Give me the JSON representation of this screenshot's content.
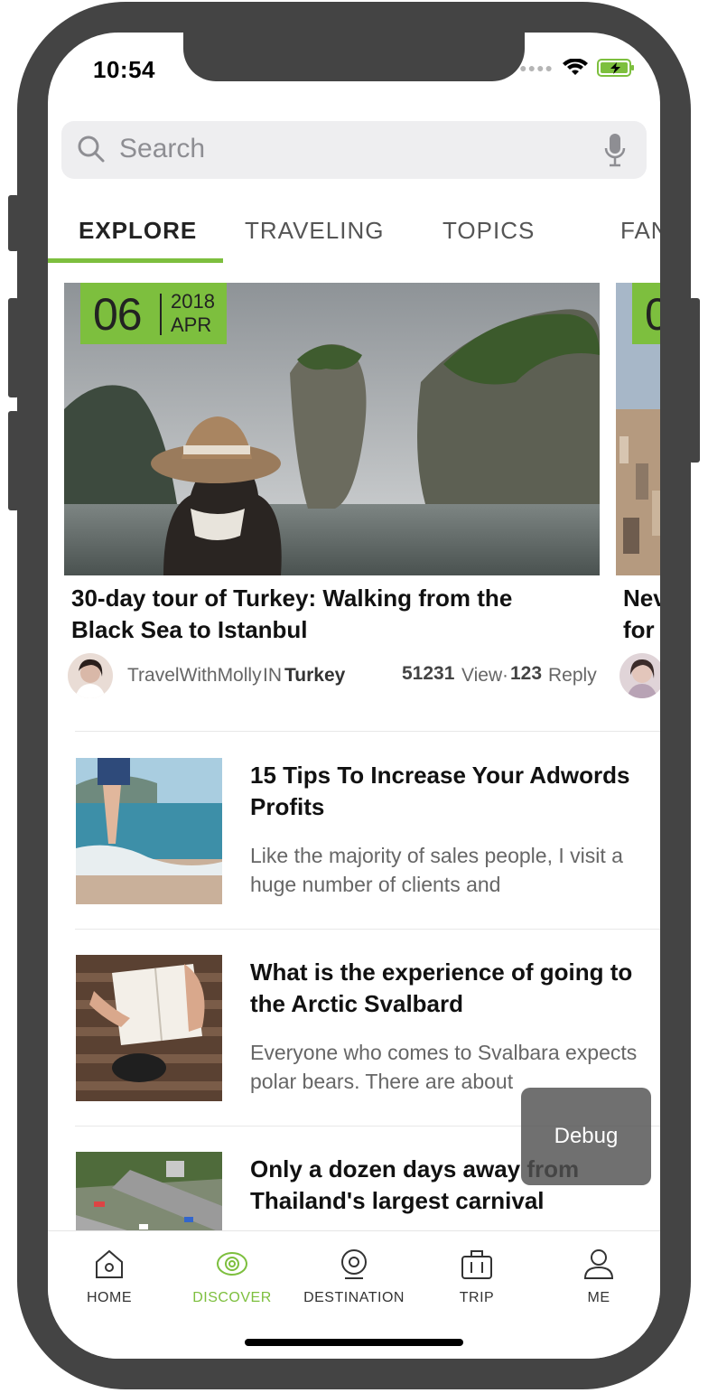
{
  "status_bar": {
    "time": "10:54"
  },
  "search": {
    "placeholder": "Search"
  },
  "tabs": [
    {
      "label": "EXPLORE",
      "active": true
    },
    {
      "label": "TRAVELING",
      "active": false
    },
    {
      "label": "TOPICS",
      "active": false
    },
    {
      "label": "FAN",
      "active": false
    }
  ],
  "featured": [
    {
      "date_day": "06",
      "date_year": "2018",
      "date_month": "APR",
      "title": "30-day tour of Turkey: Walking from the Black Sea to Istanbul",
      "author": "TravelWithMolly",
      "in_label": "IN",
      "location": "Turkey",
      "views": "51231",
      "views_label": "View",
      "sep": "·",
      "replies": "123",
      "replies_label": "Reply"
    },
    {
      "date_day": "0",
      "title_line1": "Nev",
      "title_line2": "for"
    }
  ],
  "articles": [
    {
      "title": "15 Tips To Increase Your Adwords Profits",
      "excerpt": "Like the majority of sales people, I visit a huge number of clients and"
    },
    {
      "title": "What is the experience of going to the Arctic Svalbard",
      "excerpt": "Everyone who comes to Svalbara expects polar bears. There are about"
    },
    {
      "title": "Only a dozen days away from Thailand's largest carnival",
      "excerpt": ""
    }
  ],
  "debug_button": "Debug",
  "tab_bar": [
    {
      "label": "HOME",
      "icon": "home-icon",
      "active": false
    },
    {
      "label": "DISCOVER",
      "icon": "eye-icon",
      "active": true
    },
    {
      "label": "DESTINATION",
      "icon": "location-icon",
      "active": false
    },
    {
      "label": "TRIP",
      "icon": "suitcase-icon",
      "active": false
    },
    {
      "label": "ME",
      "icon": "person-icon",
      "active": false
    }
  ],
  "colors": {
    "accent": "#7dbf3e",
    "frame": "#444444"
  }
}
